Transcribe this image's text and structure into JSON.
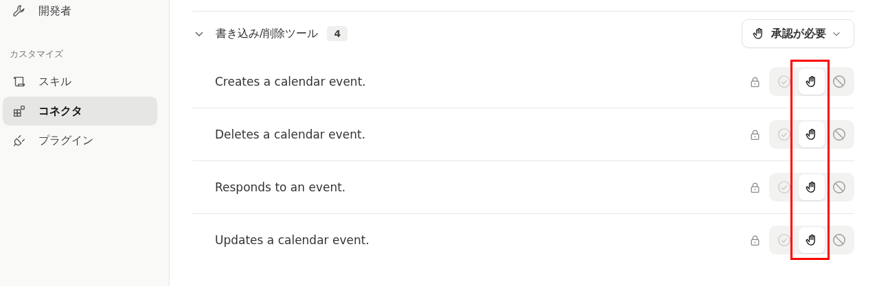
{
  "sidebar": {
    "items": [
      {
        "kind": "item",
        "label": "開発者",
        "selected": false
      },
      {
        "kind": "heading",
        "label": "カスタマイズ"
      },
      {
        "kind": "item",
        "label": "スキル",
        "selected": false
      },
      {
        "kind": "item",
        "label": "コネクタ",
        "selected": true
      },
      {
        "kind": "item",
        "label": "プラグイン",
        "selected": false
      }
    ]
  },
  "section": {
    "title": "書き込み/削除ツール",
    "count": "4",
    "expanded": true,
    "permission": {
      "label": "承認が必要"
    },
    "tools": [
      {
        "description": "Creates a calendar event.",
        "locked": true,
        "options": [
          {
            "kind": "allow",
            "selected": false
          },
          {
            "kind": "ask",
            "selected": true
          },
          {
            "kind": "block",
            "selected": false
          }
        ]
      },
      {
        "description": "Deletes a calendar event.",
        "locked": true,
        "options": [
          {
            "kind": "allow",
            "selected": false
          },
          {
            "kind": "ask",
            "selected": true
          },
          {
            "kind": "block",
            "selected": false
          }
        ]
      },
      {
        "description": "Responds to an event.",
        "locked": true,
        "options": [
          {
            "kind": "allow",
            "selected": false
          },
          {
            "kind": "ask",
            "selected": true
          },
          {
            "kind": "block",
            "selected": false
          }
        ]
      },
      {
        "description": "Updates a calendar event.",
        "locked": true,
        "options": [
          {
            "kind": "allow",
            "selected": false
          },
          {
            "kind": "ask",
            "selected": true
          },
          {
            "kind": "block",
            "selected": false
          }
        ]
      }
    ]
  }
}
